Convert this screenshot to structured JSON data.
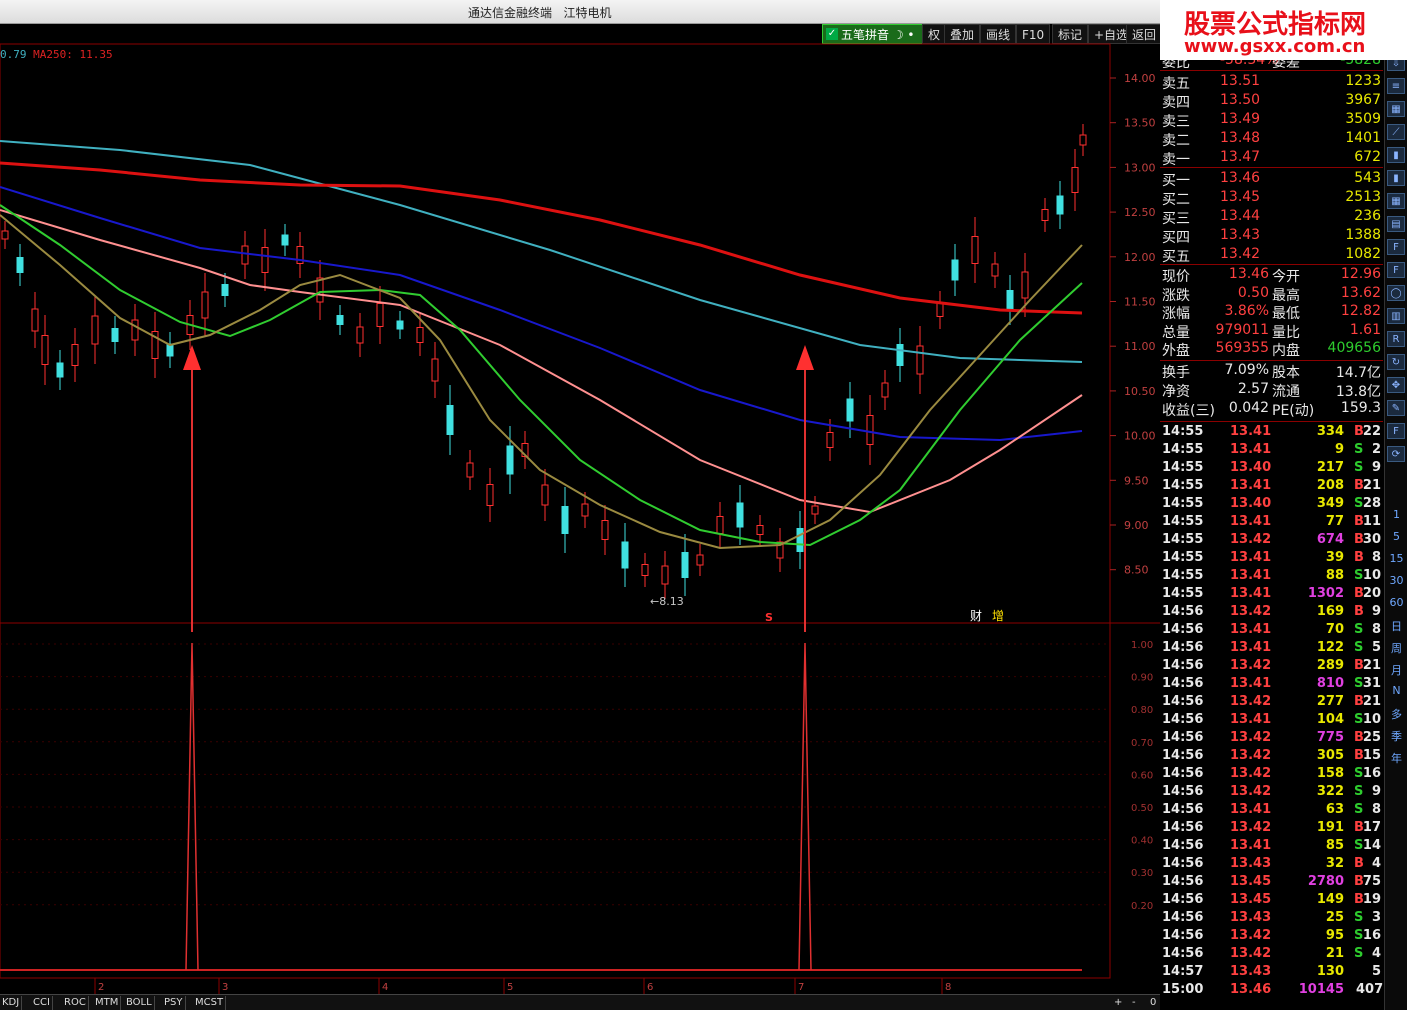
{
  "window": {
    "title": "通达信金融终端",
    "stock": "江特电机"
  },
  "toolbar": {
    "pinyin": "五笔拼音",
    "buttons": [
      "权",
      "叠加",
      "画线",
      "F10",
      "标记",
      "+自选",
      "返回"
    ]
  },
  "watermark": {
    "line1": "股票公式指标网",
    "line2": "www.gsxx.com.cn"
  },
  "ma_legend": {
    "left": "0.79",
    "ma250": "MA250: 11.35"
  },
  "price_axis": [
    "14.00",
    "13.50",
    "13.00",
    "12.50",
    "12.00",
    "11.50",
    "11.00",
    "10.50",
    "10.00",
    "9.50",
    "9.00",
    "8.50"
  ],
  "ind_axis": [
    "1.00",
    "0.90",
    "0.80",
    "0.70",
    "0.60",
    "0.50",
    "0.40",
    "0.30",
    "0.20"
  ],
  "low_marker": "8.13",
  "events": {
    "s": "S",
    "cai": "财",
    "zeng": "增"
  },
  "months": [
    "2",
    "3",
    "4",
    "5",
    "6",
    "7",
    "8"
  ],
  "quote": {
    "top": {
      "label": "委比",
      "value": "-58.34%",
      "label2": "委差",
      "value2": "-5828"
    },
    "sell": [
      {
        "l": "卖五",
        "p": "13.51",
        "v": "1233"
      },
      {
        "l": "卖四",
        "p": "13.50",
        "v": "3967"
      },
      {
        "l": "卖三",
        "p": "13.49",
        "v": "3509"
      },
      {
        "l": "卖二",
        "p": "13.48",
        "v": "1401"
      },
      {
        "l": "卖一",
        "p": "13.47",
        "v": "672"
      }
    ],
    "buy": [
      {
        "l": "买一",
        "p": "13.46",
        "v": "543"
      },
      {
        "l": "买二",
        "p": "13.45",
        "v": "2513"
      },
      {
        "l": "买三",
        "p": "13.44",
        "v": "236"
      },
      {
        "l": "买四",
        "p": "13.43",
        "v": "1388"
      },
      {
        "l": "买五",
        "p": "13.42",
        "v": "1082"
      }
    ],
    "stats": [
      {
        "l1": "现价",
        "v1": "13.46",
        "l2": "今开",
        "v2": "12.96"
      },
      {
        "l1": "涨跌",
        "v1": "0.50",
        "l2": "最高",
        "v2": "13.62"
      },
      {
        "l1": "涨幅",
        "v1": "3.86%",
        "l2": "最低",
        "v2": "12.82"
      },
      {
        "l1": "总量",
        "v1": "979011",
        "l2": "量比",
        "v2": "1.61"
      },
      {
        "l1": "外盘",
        "v1": "569355",
        "l2": "内盘",
        "v2": "409656"
      }
    ],
    "stats2": [
      {
        "l1": "换手",
        "v1": "7.09%",
        "l2": "股本",
        "v2": "14.7亿"
      },
      {
        "l1": "净资",
        "v1": "2.57",
        "l2": "流通",
        "v2": "13.8亿"
      },
      {
        "l1": "收益(三)",
        "v1": "0.042",
        "l2": "PE(动)",
        "v2": "159.3"
      }
    ]
  },
  "ticks": [
    [
      "14:55",
      "13.41",
      "334",
      "B",
      "22"
    ],
    [
      "14:55",
      "13.41",
      "9",
      "S",
      "2"
    ],
    [
      "14:55",
      "13.40",
      "217",
      "S",
      "9"
    ],
    [
      "14:55",
      "13.41",
      "208",
      "B",
      "21"
    ],
    [
      "14:55",
      "13.40",
      "349",
      "S",
      "28"
    ],
    [
      "14:55",
      "13.41",
      "77",
      "B",
      "11"
    ],
    [
      "14:55",
      "13.42",
      "674",
      "B",
      "30"
    ],
    [
      "14:55",
      "13.41",
      "39",
      "B",
      "8"
    ],
    [
      "14:55",
      "13.41",
      "88",
      "S",
      "10"
    ],
    [
      "14:55",
      "13.41",
      "1302",
      "B",
      "20"
    ],
    [
      "14:56",
      "13.42",
      "169",
      "B",
      "9"
    ],
    [
      "14:56",
      "13.41",
      "70",
      "S",
      "8"
    ],
    [
      "14:56",
      "13.41",
      "122",
      "S",
      "5"
    ],
    [
      "14:56",
      "13.42",
      "289",
      "B",
      "21"
    ],
    [
      "14:56",
      "13.41",
      "810",
      "S",
      "31"
    ],
    [
      "14:56",
      "13.42",
      "277",
      "B",
      "21"
    ],
    [
      "14:56",
      "13.41",
      "104",
      "S",
      "10"
    ],
    [
      "14:56",
      "13.42",
      "775",
      "B",
      "25"
    ],
    [
      "14:56",
      "13.42",
      "305",
      "B",
      "15"
    ],
    [
      "14:56",
      "13.42",
      "158",
      "S",
      "16"
    ],
    [
      "14:56",
      "13.42",
      "322",
      "S",
      "9"
    ],
    [
      "14:56",
      "13.41",
      "63",
      "S",
      "8"
    ],
    [
      "14:56",
      "13.42",
      "191",
      "B",
      "17"
    ],
    [
      "14:56",
      "13.41",
      "85",
      "S",
      "14"
    ],
    [
      "14:56",
      "13.43",
      "32",
      "B",
      "4"
    ],
    [
      "14:56",
      "13.45",
      "2780",
      "B",
      "75"
    ],
    [
      "14:56",
      "13.45",
      "149",
      "B",
      "19"
    ],
    [
      "14:56",
      "13.43",
      "25",
      "S",
      "3"
    ],
    [
      "14:56",
      "13.42",
      "95",
      "S",
      "16"
    ],
    [
      "14:56",
      "13.42",
      "21",
      "S",
      "4"
    ],
    [
      "14:57",
      "13.43",
      "130",
      "",
      "5"
    ],
    [
      "15:00",
      "13.46",
      "10145",
      "",
      "407"
    ]
  ],
  "rightbar": {
    "periods": [
      "1",
      "5",
      "15",
      "30",
      "60",
      "日",
      "周",
      "月",
      "N",
      "多",
      "季",
      "年"
    ]
  },
  "bottom_tabs": [
    "KDJ",
    "CCI",
    "ROC",
    "MTM",
    "BOLL",
    "PSY",
    "MCST"
  ],
  "bottom_right": [
    "+",
    "-",
    "0"
  ],
  "colors": {
    "up": "#ff3030",
    "down": "#40e0e0",
    "ma250": "#dd1111",
    "ma_cyan": "#40b0c0",
    "ma_blue": "#1818cc",
    "ma_pink": "#ff9090",
    "ma_green": "#30cc30",
    "ma_olive": "#9a8a40"
  }
}
